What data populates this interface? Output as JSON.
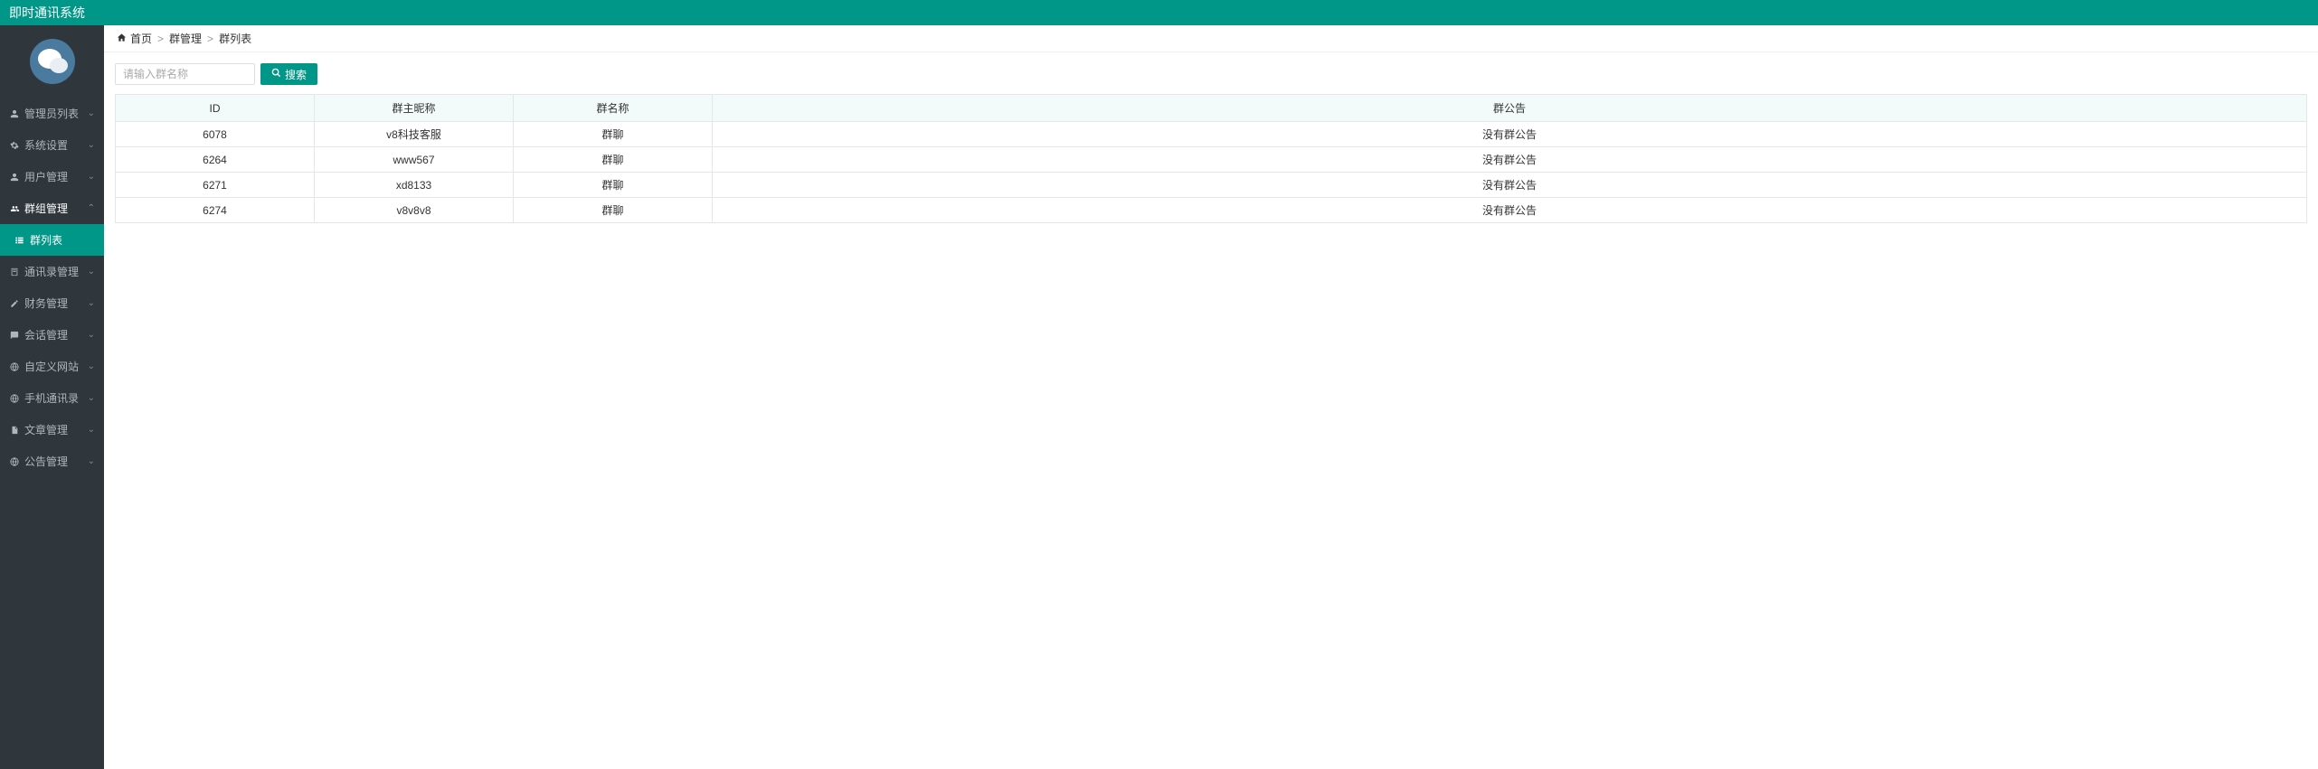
{
  "header": {
    "title": "即时通讯系统"
  },
  "sidebar": {
    "items": [
      {
        "label": "管理员列表",
        "icon": "user"
      },
      {
        "label": "系统设置",
        "icon": "gear"
      },
      {
        "label": "用户管理",
        "icon": "user"
      },
      {
        "label": "群组管理",
        "icon": "users",
        "expanded": true,
        "children": [
          {
            "label": "群列表",
            "active": true
          }
        ]
      },
      {
        "label": "通讯录管理",
        "icon": "book"
      },
      {
        "label": "财务管理",
        "icon": "edit"
      },
      {
        "label": "会话管理",
        "icon": "chat"
      },
      {
        "label": "自定义网站",
        "icon": "globe"
      },
      {
        "label": "手机通讯录",
        "icon": "phone"
      },
      {
        "label": "文章管理",
        "icon": "doc"
      },
      {
        "label": "公告管理",
        "icon": "bell"
      }
    ]
  },
  "breadcrumb": {
    "home": "首页",
    "mid": "群管理",
    "last": "群列表"
  },
  "search": {
    "placeholder": "请输入群名称",
    "button": "搜索"
  },
  "table": {
    "headers": {
      "id": "ID",
      "owner": "群主昵称",
      "name": "群名称",
      "notice": "群公告"
    },
    "rows": [
      {
        "id": "6078",
        "owner": "v8科技客服",
        "name": "群聊",
        "notice": "没有群公告"
      },
      {
        "id": "6264",
        "owner": "www567",
        "name": "群聊",
        "notice": "没有群公告"
      },
      {
        "id": "6271",
        "owner": "xd8133",
        "name": "群聊",
        "notice": "没有群公告"
      },
      {
        "id": "6274",
        "owner": "v8v8v8",
        "name": "群聊",
        "notice": "没有群公告"
      }
    ]
  }
}
